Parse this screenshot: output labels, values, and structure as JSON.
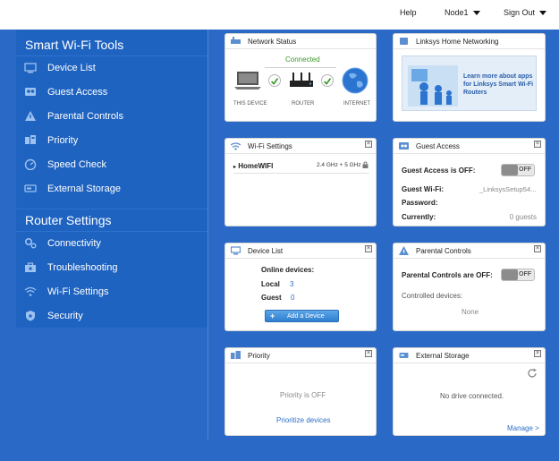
{
  "topbar": {
    "help": "Help",
    "node": "Node1",
    "sign_out": "Sign Out"
  },
  "sidebar": {
    "tools_heading": "Smart Wi-Fi Tools",
    "tools": [
      {
        "label": "Device List",
        "icon": "monitor-icon"
      },
      {
        "label": "Guest Access",
        "icon": "guest-icon"
      },
      {
        "label": "Parental Controls",
        "icon": "warning-icon"
      },
      {
        "label": "Priority",
        "icon": "priority-icon"
      },
      {
        "label": "Speed Check",
        "icon": "gauge-icon"
      },
      {
        "label": "External Storage",
        "icon": "storage-icon"
      }
    ],
    "router_heading": "Router Settings",
    "router": [
      {
        "label": "Connectivity",
        "icon": "gears-icon"
      },
      {
        "label": "Troubleshooting",
        "icon": "toolbox-icon"
      },
      {
        "label": "Wi-Fi Settings",
        "icon": "wifi-icon"
      },
      {
        "label": "Security",
        "icon": "shield-icon"
      }
    ]
  },
  "network_status": {
    "title": "Network Status",
    "status": "Connected",
    "this_device": "THIS DEVICE",
    "router": "ROUTER",
    "internet": "INTERNET"
  },
  "linksys_home": {
    "title": "Linksys Home Networking",
    "promo": "Learn more about apps for Linksys Smart Wi-Fi Routers"
  },
  "wifi_settings": {
    "title": "Wi-Fi Settings",
    "network_name": "HomeWIFI",
    "bands": "2.4 GHz + 5 GHz"
  },
  "guest_access": {
    "title": "Guest Access",
    "status_label": "Guest Access is OFF:",
    "toggle": "OFF",
    "wifi_label": "Guest Wi-Fi:",
    "wifi_value": "_LinksysSetup54...",
    "password_label": "Password:",
    "currently_label": "Currently:",
    "currently_value": "0 guests"
  },
  "device_list": {
    "title": "Device List",
    "online_label": "Online devices:",
    "local_label": "Local",
    "local_count": "3",
    "guest_label": "Guest",
    "guest_count": "0",
    "add_button": "Add a Device"
  },
  "parental_controls": {
    "title": "Parental Controls",
    "status_label": "Parental Controls are OFF:",
    "toggle": "OFF",
    "controlled_label": "Controlled devices:",
    "controlled_value": "None"
  },
  "priority": {
    "title": "Priority",
    "status": "Priority is OFF",
    "link": "Prioritize devices"
  },
  "external_storage": {
    "title": "External Storage",
    "status": "No drive connected.",
    "link": "Manage >"
  },
  "colors": {
    "background": "#2a6ac6",
    "sidebar": "#1f63c1",
    "card": "#ffffff",
    "connected_green": "#3c9a2a",
    "link_blue": "#2d6fc7"
  }
}
